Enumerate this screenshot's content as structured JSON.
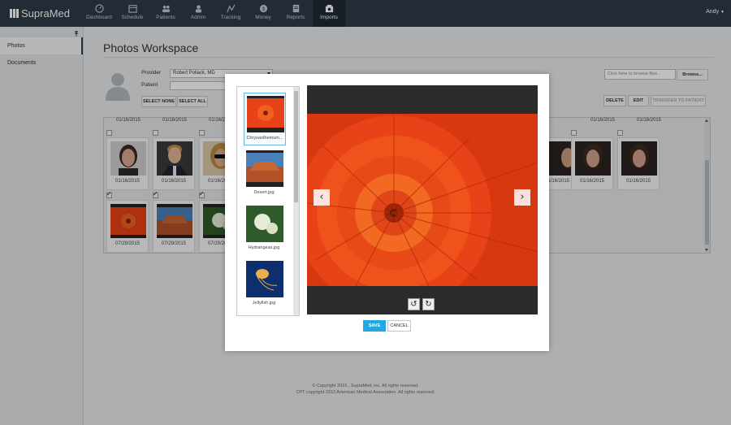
{
  "app": {
    "name": "SupraMed"
  },
  "nav": {
    "items": [
      {
        "label": "Dashboard",
        "icon": "dashboard-icon"
      },
      {
        "label": "Schedule",
        "icon": "calendar-icon"
      },
      {
        "label": "Patients",
        "icon": "patients-icon"
      },
      {
        "label": "Admin",
        "icon": "admin-icon"
      },
      {
        "label": "Tracking",
        "icon": "tracking-icon"
      },
      {
        "label": "Money",
        "icon": "money-icon"
      },
      {
        "label": "Reports",
        "icon": "reports-icon"
      },
      {
        "label": "Imports",
        "icon": "imports-icon",
        "active": true
      }
    ],
    "user": "Andy"
  },
  "sidebar": {
    "items": [
      {
        "label": "Photos",
        "active": true
      },
      {
        "label": "Documents"
      }
    ]
  },
  "page": {
    "title": "Photos Workspace",
    "provider_label": "Provider",
    "provider_value": "Robert Pollack, MD",
    "patient_label": "Patient",
    "select_none": "SELECT NONE",
    "select_all": "SELECT ALL",
    "browse_placeholder": "Click here to browse files...",
    "browse_button": "Browse...",
    "delete_button": "DELETE",
    "edit_button": "EDIT",
    "transfer_button": "TRANSFER TO PATIENT"
  },
  "grid": {
    "row0_dates_left": [
      "01/16/2015",
      "01/16/2015",
      "01/16/2015"
    ],
    "row0_dates_right": [
      "01/16/2015",
      "01/16/2015"
    ],
    "row1_left": [
      {
        "date": "01/16/2015",
        "kind": "person"
      },
      {
        "date": "01/16/2015",
        "kind": "person"
      },
      {
        "date": "01/16/2015",
        "kind": "person"
      }
    ],
    "row1_right": [
      {
        "date": "01/16/2015",
        "kind": "person"
      },
      {
        "date": "01/16/2015",
        "kind": "person"
      },
      {
        "date": "01/16/2015",
        "kind": "person"
      }
    ],
    "row2_left": [
      {
        "date": "07/29/2015",
        "kind": "flower"
      },
      {
        "date": "07/29/2015",
        "kind": "desert"
      },
      {
        "date": "07/29/2015",
        "kind": "hydrangea"
      }
    ]
  },
  "modal": {
    "files": [
      {
        "caption": "Chrysanthemum...",
        "kind": "flower",
        "selected": true
      },
      {
        "caption": "Desert.jpg",
        "kind": "desert"
      },
      {
        "caption": "Hydrangeas.jpg",
        "kind": "hydrangea"
      },
      {
        "caption": "Jellyfish.jpg",
        "kind": "jellyfish"
      }
    ],
    "prev_label": "‹",
    "next_label": "›",
    "rotate_left_label": "↺",
    "rotate_right_label": "↻",
    "save_label": "SAVE",
    "cancel_label": "CANCEL"
  },
  "footer": {
    "line1": "© Copyright 2015 , SupraMed, inc. All rights reserved.",
    "line2": "CPT copyright 2013 American Medical Association. All rights reserved."
  },
  "colors": {
    "nav_bg": "#2f3b48",
    "accent": "#23a9e1",
    "flower": "#e84318"
  }
}
